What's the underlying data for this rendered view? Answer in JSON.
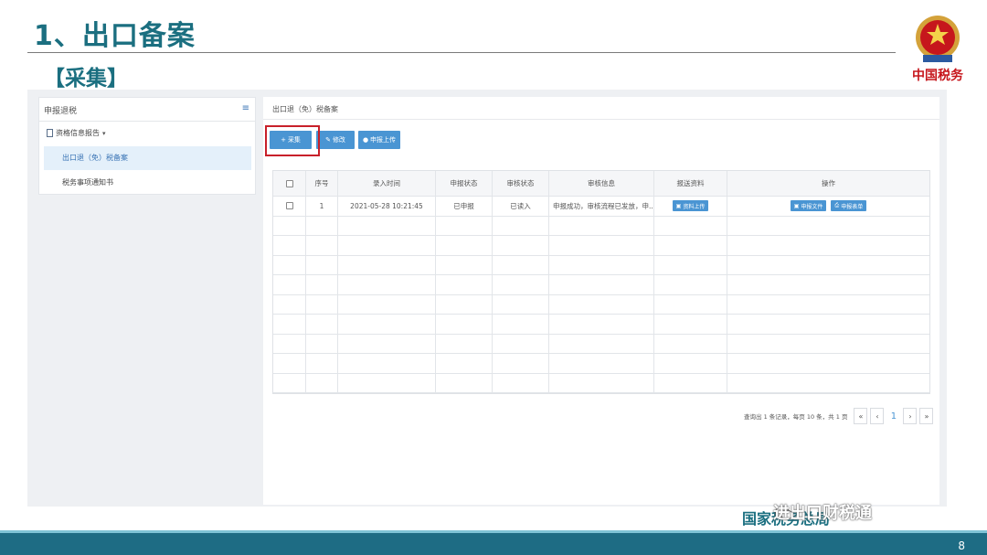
{
  "slide": {
    "title": "1、出口备案",
    "subtitle": "【采集】",
    "emblem_text": "中国税务",
    "footer_org": "国家税务总局",
    "watermark": "进出口财税通",
    "page_number": "8"
  },
  "sidebar": {
    "header": "申报退税",
    "group_label": "资格信息报告",
    "items": [
      {
        "label": "出口退（免）税备案",
        "active": true
      },
      {
        "label": "税务事项通知书",
        "active": false
      }
    ]
  },
  "main": {
    "breadcrumb": "出口退（免）税备案",
    "toolbar": {
      "collect_label": "采集",
      "modify_label": "修改",
      "upload_label": "申报上传"
    },
    "table": {
      "columns": [
        "序号",
        "录入时间",
        "申报状态",
        "审核状态",
        "审核信息",
        "报送资料",
        "操作"
      ],
      "rows": [
        {
          "index": "1",
          "entry_time": "2021-05-28 10:21:45",
          "declare_status": "已申报",
          "review_status": "已读入",
          "review_info": "申报成功，审核流程已发放，申...",
          "submit_btn": "资料上传",
          "action_file": "申报文件",
          "action_print": "申报表单"
        }
      ],
      "empty_rows": 9
    },
    "pager": {
      "summary": "查询出 1 条记录，每页 10 条，共 1 页",
      "first": "«",
      "prev": "‹",
      "current": "1",
      "next": "›",
      "last": "»"
    }
  },
  "colors": {
    "accent": "#4a95d3",
    "title": "#1b6f80",
    "highlight": "#c8202a",
    "footer_bar": "#1e6c84"
  }
}
